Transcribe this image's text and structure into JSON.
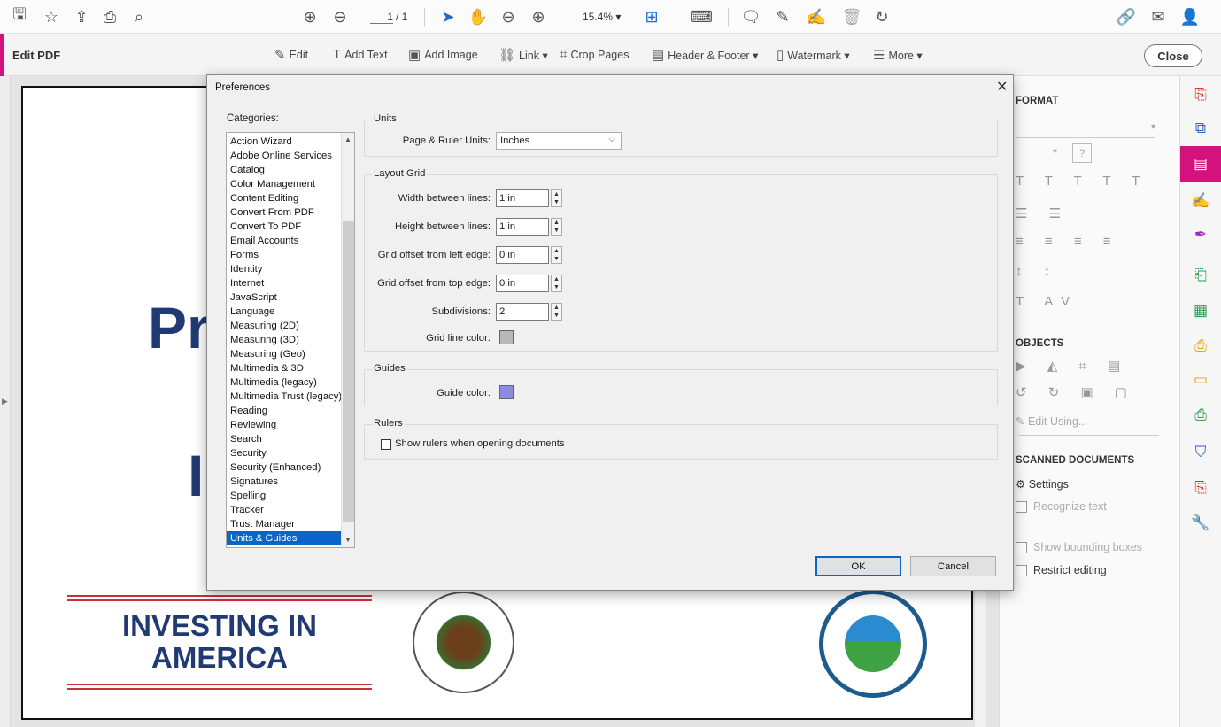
{
  "toolbar": {
    "page_current": "1",
    "page_total": "/ 1",
    "zoom": "15.4%"
  },
  "edit_bar": {
    "title": "Edit PDF",
    "tools": [
      "Edit",
      "Add Text",
      "Add Image",
      "Link ▾",
      "Crop Pages",
      "Header & Footer ▾",
      "Watermark ▾",
      "More ▾"
    ],
    "close_label": "Close"
  },
  "document": {
    "heading_fragment_1": "Pr",
    "heading_fragment_2": "I",
    "investing_line1": "INVESTING IN",
    "investing_line2": "AMERICA"
  },
  "right_panel": {
    "format_heading": "FORMAT",
    "objects_heading": "OBJECTS",
    "edit_using": "Edit Using...",
    "scanned_heading": "SCANNED DOCUMENTS",
    "settings": "Settings",
    "recognize_text": "Recognize text",
    "show_bounding_boxes": "Show bounding boxes",
    "restrict_editing": "Restrict editing"
  },
  "dialog": {
    "title": "Preferences",
    "categories_label": "Categories:",
    "categories": [
      "Action Wizard",
      "Adobe Online Services",
      "Catalog",
      "Color Management",
      "Content Editing",
      "Convert From PDF",
      "Convert To PDF",
      "Email Accounts",
      "Forms",
      "Identity",
      "Internet",
      "JavaScript",
      "Language",
      "Measuring (2D)",
      "Measuring (3D)",
      "Measuring (Geo)",
      "Multimedia & 3D",
      "Multimedia (legacy)",
      "Multimedia Trust (legacy)",
      "Reading",
      "Reviewing",
      "Search",
      "Security",
      "Security (Enhanced)",
      "Signatures",
      "Spelling",
      "Tracker",
      "Trust Manager",
      "Units & Guides"
    ],
    "selected_category": "Units & Guides",
    "units": {
      "group_label": "Units",
      "page_ruler_label": "Page & Ruler Units:",
      "page_ruler_value": "Inches"
    },
    "layout_grid": {
      "group_label": "Layout Grid",
      "width_label": "Width between lines:",
      "width_value": "1 in",
      "height_label": "Height between lines:",
      "height_value": "1 in",
      "offset_left_label": "Grid offset from left edge:",
      "offset_left_value": "0 in",
      "offset_top_label": "Grid offset from top edge:",
      "offset_top_value": "0 in",
      "subdivisions_label": "Subdivisions:",
      "subdivisions_value": "2",
      "line_color_label": "Grid line color:",
      "line_color": "#b8b8b8"
    },
    "guides": {
      "group_label": "Guides",
      "guide_color_label": "Guide color:",
      "guide_color": "#8a8ae0"
    },
    "rulers": {
      "group_label": "Rulers",
      "show_rulers_label": "Show rulers when opening documents",
      "show_rulers_checked": false
    },
    "ok_label": "OK",
    "cancel_label": "Cancel"
  },
  "colors": {
    "accent": "#d3127d",
    "selection": "#0a65c8",
    "doc_heading": "#213a73"
  }
}
